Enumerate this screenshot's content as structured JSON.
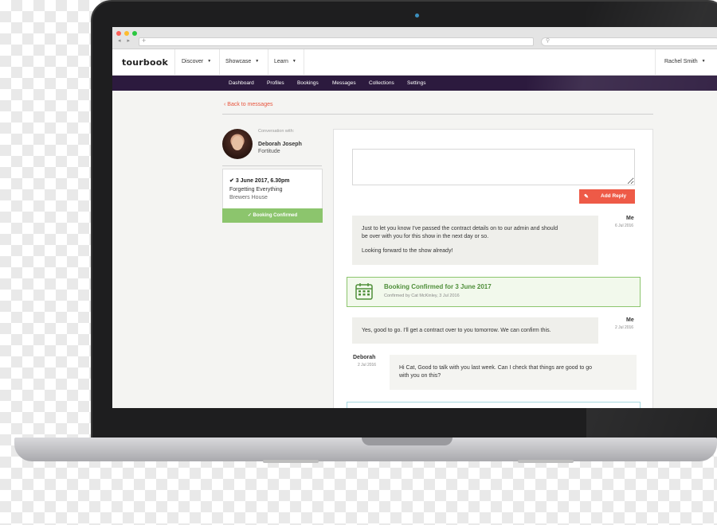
{
  "browser": {
    "nav_arrows": "◂ ▸",
    "new_tab": "+",
    "search_icon": "search-icon"
  },
  "app": {
    "logo": "tourbook"
  },
  "topnav": {
    "items": [
      {
        "label": "Discover"
      },
      {
        "label": "Showcase"
      },
      {
        "label": "Learn"
      }
    ],
    "user": "Rachel Smith"
  },
  "subnav": {
    "items": [
      {
        "label": "Dashboard"
      },
      {
        "label": "Profiles"
      },
      {
        "label": "Bookings"
      },
      {
        "label": "Messages"
      },
      {
        "label": "Collections"
      },
      {
        "label": "Settings"
      }
    ]
  },
  "back_link": "Back to messages",
  "conversation": {
    "label": "Conversation with:",
    "name": "Deborah Joseph",
    "act": "Fortitude"
  },
  "booking": {
    "date": "3 June 2017, 6.30pm",
    "title": "Forgetting Everything",
    "venue": "Brewers House",
    "status": "Booking Confirmed"
  },
  "reply": {
    "placeholder": "",
    "button": "Add Reply"
  },
  "messages": [
    {
      "sender": "Me",
      "time": "6 Jul 2016",
      "lines": [
        "Just to let you know I've passed the contract details on to our admin and should",
        "be over with you for this show in the next day or so.",
        "Looking forward to the show already!"
      ]
    },
    {
      "sender": "Me",
      "time": "2 Jul 2016",
      "lines": [
        "Yes, good to go. I'll get a contract over to you tomorrow. We can confirm this."
      ]
    },
    {
      "sender": "Deborah",
      "time": "2 Jul 2016",
      "lines": [
        "Hi Cat, Good to talk with you last week. Can I check that things are good to go",
        "with you on this?"
      ]
    }
  ],
  "confirmation": {
    "title": "Booking Confirmed for 3 June 2017",
    "subtitle": "Confirmed by Cat McKinley, 3 Jul 2016"
  },
  "colors": {
    "accent": "#ee5a47",
    "subnav_bg": "#2c1a3e",
    "confirm_green": "#8cc56d",
    "confirm_text": "#4f8f3a"
  }
}
